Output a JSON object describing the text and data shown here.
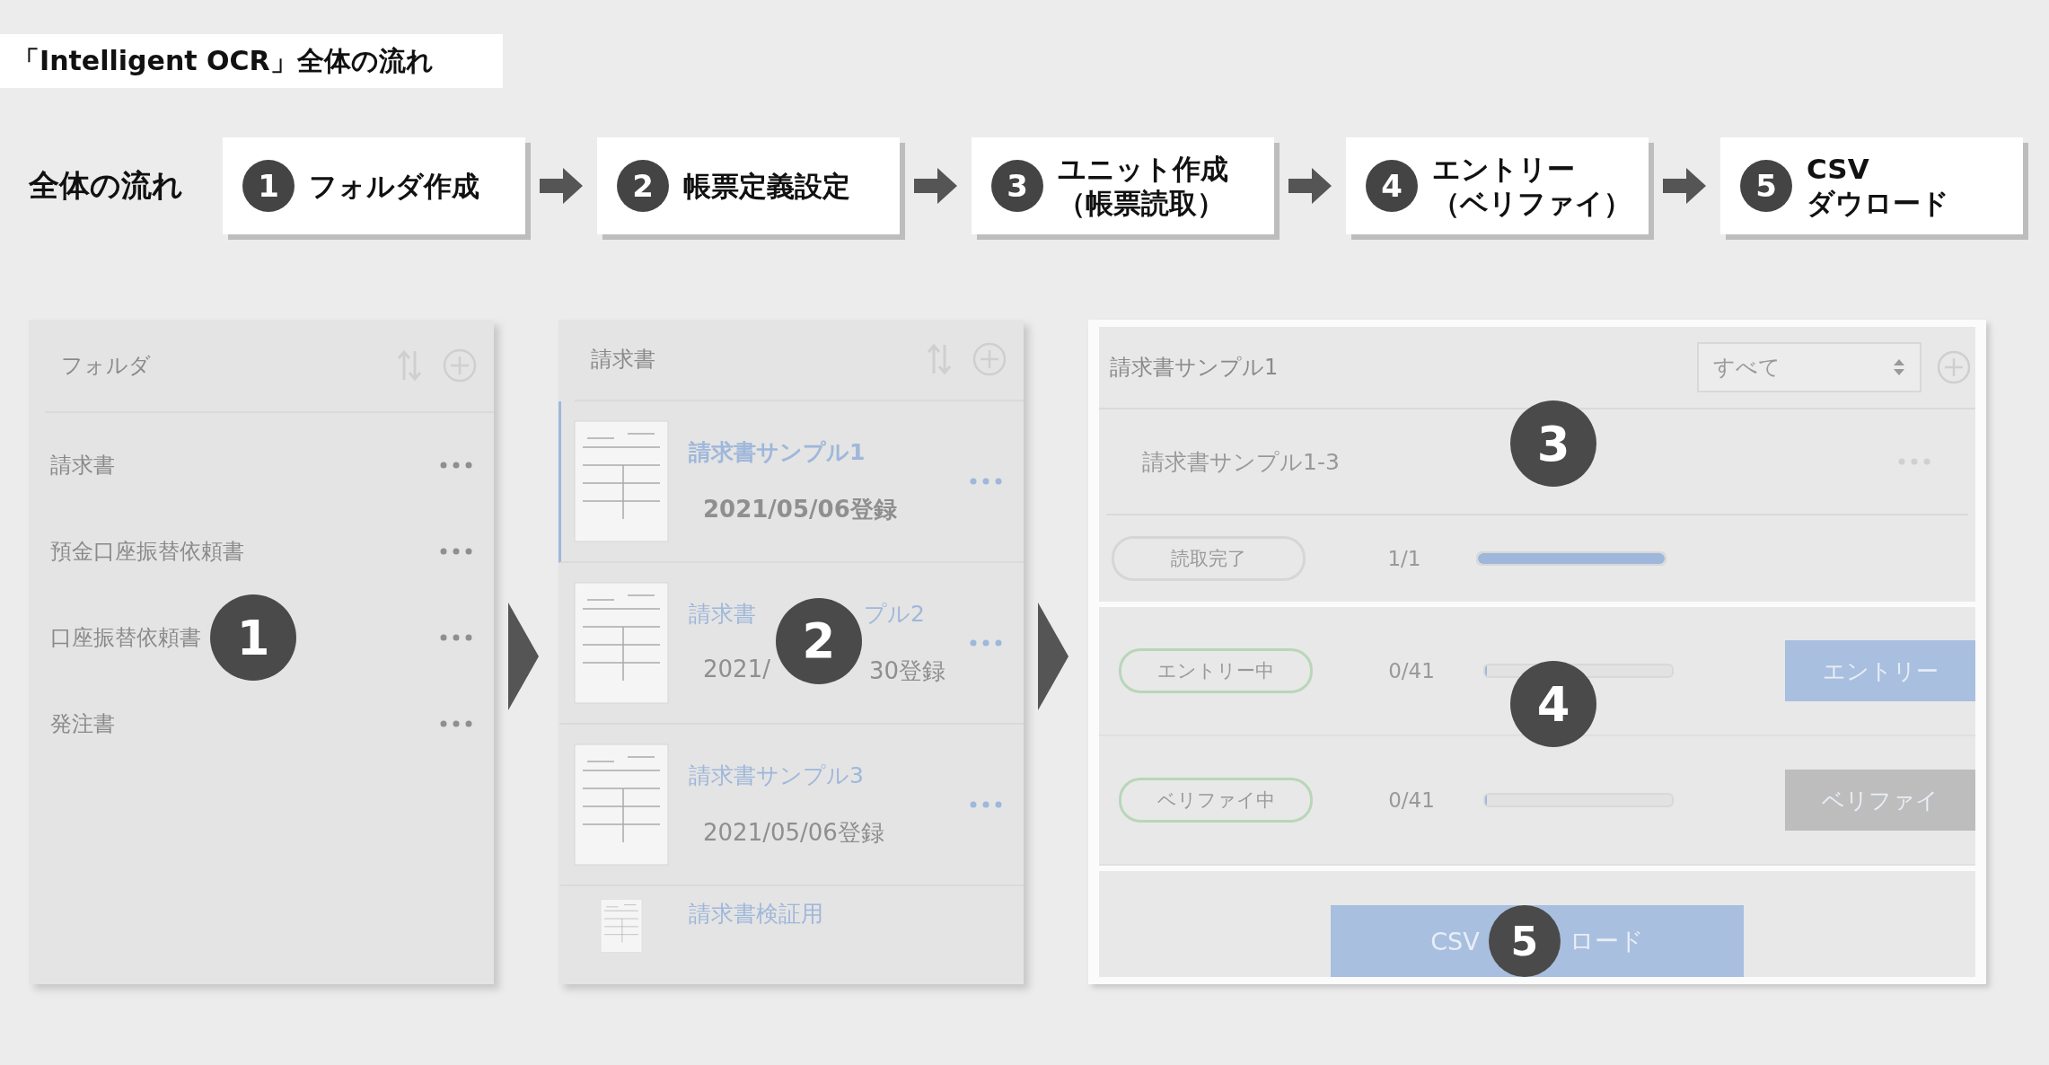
{
  "title": "「Intelligent OCR」全体の流れ",
  "flow": {
    "label": "全体の流れ",
    "steps": [
      {
        "number": "1",
        "lines": [
          "フォルダ作成"
        ]
      },
      {
        "number": "2",
        "lines": [
          "帳票定義設定"
        ]
      },
      {
        "number": "3",
        "lines": [
          "ユニット作成",
          "（帳票読取）"
        ]
      },
      {
        "number": "4",
        "lines": [
          "エントリー",
          "（ベリファイ）"
        ]
      },
      {
        "number": "5",
        "lines": [
          "CSV",
          "ダウロード"
        ]
      }
    ]
  },
  "folder_panel": {
    "title": "フォルダ",
    "badge": "1",
    "items": [
      {
        "name_parts": [
          "請求書"
        ]
      },
      {
        "name_parts": [
          "預金口座振替依頼書"
        ]
      },
      {
        "name_parts": [
          "口座振替依頼書"
        ],
        "badge": true
      },
      {
        "name_parts": [
          "発注書"
        ]
      }
    ]
  },
  "document_panel": {
    "title": "請求書",
    "badge": "2",
    "items": [
      {
        "name_parts": [
          "請求書サンプル1"
        ],
        "date_parts": [
          "2021/05/06登録"
        ],
        "selected": true
      },
      {
        "name_parts": [
          "請求書",
          "プル2"
        ],
        "date_parts": [
          "2021/",
          "30登録"
        ],
        "selected": false,
        "badge": true
      },
      {
        "name_parts": [
          "請求書サンプル3"
        ],
        "date_parts": [
          "2021/05/06登録"
        ],
        "selected": false
      },
      {
        "name_parts": [
          "請求書検証用"
        ],
        "selected": false
      }
    ]
  },
  "unit_panel": {
    "title": "請求書サンプル1",
    "filter": "すべて",
    "unit_name": "請求書サンプル1-3",
    "badges": [
      "3",
      "4",
      "5"
    ],
    "read_row": {
      "status": "読取完了",
      "count": "1/1",
      "level": 1
    },
    "entry_rows": [
      {
        "status": "エントリー中",
        "count": "0/41",
        "level": 0,
        "button": "エントリー",
        "kind": "primary"
      },
      {
        "status": "ベリファイ中",
        "count": "0/41",
        "level": 0,
        "button": "ベリファイ",
        "kind": "disabled"
      }
    ],
    "csv_parts": [
      "CSV",
      "ロード"
    ]
  }
}
